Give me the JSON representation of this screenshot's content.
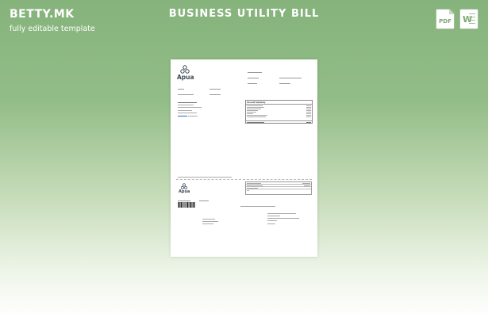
{
  "brand": {
    "name": "BETTY.MK",
    "tagline": "fully editable template"
  },
  "title": "BUSINESS UTILITY BILL",
  "formats": [
    {
      "label": "PDF",
      "icon": "pdf-file-icon"
    },
    {
      "label": "W",
      "icon": "word-file-icon"
    }
  ],
  "colors": {
    "accent_green": "#85b37b",
    "logo_blue": "#3d4a55"
  },
  "document": {
    "logo_text": "Apua",
    "stub_logo_text": "Apua",
    "summary_header": "Account Summary"
  }
}
